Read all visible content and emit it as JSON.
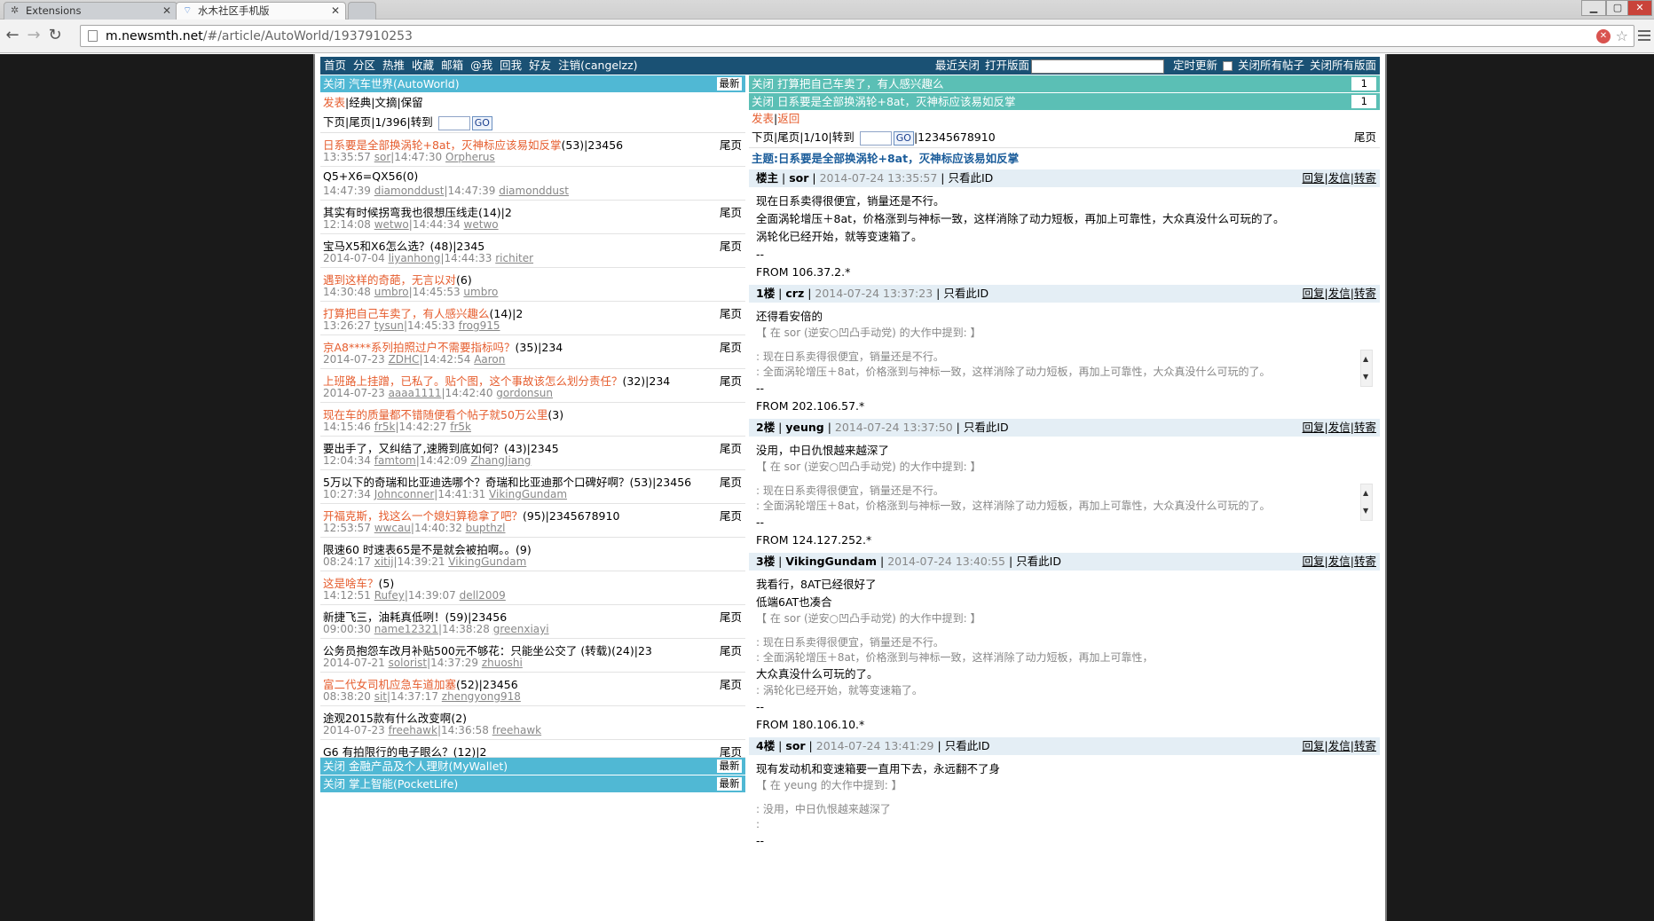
{
  "browser": {
    "tabs": [
      {
        "label": "Extensions",
        "icon": "puzzle-icon"
      },
      {
        "label": "水木社区手机版",
        "icon": "smth-icon"
      }
    ],
    "url_host": "m.newsmth.net",
    "url_path": "/#/article/AutoWorld/1937910253"
  },
  "topbar": {
    "nav": [
      "首页",
      "分区",
      "热推",
      "收藏",
      "邮箱",
      "@我",
      "回我",
      "好友",
      "注销(cangelzz)"
    ],
    "right_links": [
      "最近关闭",
      "打开版面"
    ],
    "refresh": "定时更新",
    "close_all_posts": "关闭所有帖子",
    "close_all_boards": "关闭所有版面"
  },
  "left": {
    "board_bar": {
      "close": "关闭",
      "name": "汽车世界(AutoWorld)",
      "latest": "最新"
    },
    "actions": {
      "post": "发表",
      "rest": "|经典|文摘|保留"
    },
    "pager": {
      "next": "下页",
      "sep1": "|",
      "last": "尾页",
      "sep2": "|",
      "page": "1/396",
      "sep3": "|",
      "goto": "转到",
      "go": "GO"
    },
    "threads": [
      {
        "title": "日系要是全部换涡轮+8at，灭神标应该易如反掌",
        "meta": "(53)|23456",
        "hot": true,
        "tail": "尾页",
        "time": "13:35:57",
        "author": "sor",
        "rtime": "14:47:30",
        "rauthor": "Orpherus"
      },
      {
        "title": "Q5+X6=QX56",
        "meta": "(0)",
        "hot": false,
        "tail": "",
        "time": "14:47:39",
        "author": "diamonddust",
        "rtime": "14:47:39",
        "rauthor": "diamonddust"
      },
      {
        "title": "其实有时候拐弯我也很想压线走",
        "meta": "(14)|2",
        "hot": false,
        "tail": "尾页",
        "time": "12:14:08",
        "author": "wetwo",
        "rtime": "14:44:34",
        "rauthor": "wetwo"
      },
      {
        "title": "宝马X5和X6怎么选？",
        "meta": "(48)|2345",
        "hot": false,
        "tail": "尾页",
        "time": "2014-07-04",
        "author": "liyanhong",
        "rtime": "14:44:33",
        "rauthor": "richiter"
      },
      {
        "title": "遇到这样的奇葩，无言以对",
        "meta": "(6)",
        "hot": true,
        "tail": "",
        "time": "14:30:48",
        "author": "umbro",
        "rtime": "14:45:53",
        "rauthor": "umbro"
      },
      {
        "title": "打算把自己车卖了，有人感兴趣么",
        "meta": "(14)|2",
        "hot": true,
        "tail": "尾页",
        "time": "13:26:27",
        "author": "tysun",
        "rtime": "14:45:33",
        "rauthor": "frog915"
      },
      {
        "title": "京A8****系列拍照过户不需要指标吗？",
        "meta": "(35)|234",
        "hot": true,
        "tail": "尾页",
        "time": "2014-07-23",
        "author": "ZDHC",
        "rtime": "14:42:54",
        "rauthor": "Aaron"
      },
      {
        "title": "上班路上挂蹭，已私了。贴个图，这个事故该怎么划分责任？",
        "meta": "(32)|234",
        "hot": true,
        "tail": "尾页",
        "time": "2014-07-23",
        "author": "aaaa1111",
        "rtime": "14:42:40",
        "rauthor": "gordonsun"
      },
      {
        "title": "现在车的质量都不错随便看个帖子就50万公里",
        "meta": "(3)",
        "hot": true,
        "tail": "",
        "time": "14:15:46",
        "author": "fr5k",
        "rtime": "14:42:27",
        "rauthor": "fr5k"
      },
      {
        "title": "要出手了，又纠结了,速腾到底如何？",
        "meta": "(43)|2345",
        "hot": false,
        "tail": "尾页",
        "time": "12:04:34",
        "author": "famtom",
        "rtime": "14:42:09",
        "rauthor": "ZhangJiang"
      },
      {
        "title": "5万以下的奇瑞和比亚迪选哪个？奇瑞和比亚迪那个口碑好啊？",
        "meta": "(53)|23456",
        "hot": false,
        "tail": "尾页",
        "time": "10:27:34",
        "author": "Johnconner",
        "rtime": "14:41:31",
        "rauthor": "VikingGundam"
      },
      {
        "title": "开福克斯，找这么一个媳妇算稳拿了吧？",
        "meta": "(95)|2345678910",
        "hot": true,
        "tail": "尾页",
        "time": "12:53:57",
        "author": "wwcau",
        "rtime": "14:40:32",
        "rauthor": "bupthzl"
      },
      {
        "title": "限速60 时速表65是不是就会被拍啊。。",
        "meta": "(9)",
        "hot": false,
        "tail": "",
        "time": "08:24:17",
        "author": "xitij",
        "rtime": "14:39:21",
        "rauthor": "VikingGundam"
      },
      {
        "title": "这是啥车？",
        "meta": "(5)",
        "hot": true,
        "tail": "",
        "time": "14:12:51",
        "author": "Rufey",
        "rtime": "14:39:07",
        "rauthor": "dell2009"
      },
      {
        "title": "新捷飞三，油耗真低咧！",
        "meta": "(59)|23456",
        "hot": false,
        "tail": "尾页",
        "time": "09:00:30",
        "author": "name12321",
        "rtime": "14:38:28",
        "rauthor": "greenxiayi"
      },
      {
        "title": "公务员抱怨车改月补贴500元不够花：只能坐公交了 (转载)",
        "meta": "(24)|23",
        "hot": false,
        "tail": "尾页",
        "time": "2014-07-21",
        "author": "solorist",
        "rtime": "14:37:29",
        "rauthor": "zhuoshi"
      },
      {
        "title": "富二代女司机应急车道加塞",
        "meta": "(52)|23456",
        "hot": true,
        "tail": "尾页",
        "time": "08:38:20",
        "author": "sit",
        "rtime": "14:37:17",
        "rauthor": "zhengyong918"
      },
      {
        "title": "途观2015款有什么改变啊",
        "meta": "(2)",
        "hot": false,
        "tail": "",
        "time": "2014-07-23",
        "author": "freehawk",
        "rtime": "14:36:58",
        "rauthor": "freehawk"
      },
      {
        "title": "G6 有拍限行的电子眼么？",
        "meta": "(12)|2",
        "hot": false,
        "tail": "尾页",
        "time": "",
        "author": "",
        "rtime": "",
        "rauthor": ""
      }
    ],
    "bottom_bars": [
      {
        "close": "关闭",
        "name": "金融产品及个人理财(MyWallet)",
        "latest": "最新"
      },
      {
        "close": "关闭",
        "name": "掌上智能(PocketLife)",
        "latest": "最新"
      }
    ]
  },
  "right": {
    "open_posts": [
      {
        "close": "关闭",
        "title": "打算把自己车卖了，有人感兴趣么",
        "count": "1"
      },
      {
        "close": "关闭",
        "title": "日系要是全部换涡轮+8at，灭神标应该易如反掌",
        "count": "1"
      }
    ],
    "actions": {
      "post": "发表",
      "back": "返回"
    },
    "pager": {
      "next": "下页",
      "last": "尾页",
      "page": "1/10",
      "goto": "转到",
      "go": "GO",
      "pages": "12345678910",
      "tail": "尾页"
    },
    "topic": "主题:日系要是全部换涡轮+8at，灭神标应该易如反掌",
    "posts": [
      {
        "floor": "楼主",
        "author": "sor",
        "time": "2014-07-24 13:35:57",
        "only": "只看此ID",
        "ops": [
          "回复",
          "发信",
          "转寄"
        ],
        "lines": [
          "现在日系卖得很便宜，销量还是不行。",
          "全面涡轮增压＋8at，价格涨到与神标一致，这样消除了动力短板，再加上可靠性，大众真没什么可玩的了。",
          "涡轮化已经开始，就等变速箱了。"
        ],
        "sep": "--",
        "quote_head": "",
        "quote": [],
        "after": [],
        "from": "FROM 106.37.2.*"
      },
      {
        "floor": "1楼",
        "author": "crz",
        "time": "2014-07-24 13:37:23",
        "only": "只看此ID",
        "ops": [
          "回复",
          "发信",
          "转寄"
        ],
        "lines": [
          "还得看安倍的"
        ],
        "quote_head": "【 在 sor (逆安○凹凸手动党) 的大作中提到: 】",
        "quote": [
          ": 现在日系卖得很便宜，销量还是不行。",
          ": 全面涡轮增压＋8at，价格涨到与神标一致，这样消除了动力短板，再加上可靠性，大众真没什么可玩的了。"
        ],
        "after": [],
        "sep": "--",
        "from": "FROM 202.106.57.*"
      },
      {
        "floor": "2楼",
        "author": "yeung",
        "time": "2014-07-24 13:37:50",
        "only": "只看此ID",
        "ops": [
          "回复",
          "发信",
          "转寄"
        ],
        "lines": [
          "没用，中日仇恨越来越深了"
        ],
        "quote_head": "【 在 sor (逆安○凹凸手动党) 的大作中提到: 】",
        "quote": [
          ": 现在日系卖得很便宜，销量还是不行。",
          ": 全面涡轮增压＋8at，价格涨到与神标一致，这样消除了动力短板，再加上可靠性，大众真没什么可玩的了。"
        ],
        "after": [],
        "sep": "--",
        "from": "FROM 124.127.252.*"
      },
      {
        "floor": "3楼",
        "author": "VikingGundam",
        "time": "2014-07-24 13:40:55",
        "only": "只看此ID",
        "ops": [
          "回复",
          "发信",
          "转寄"
        ],
        "lines": [
          "我看行，8AT已经很好了",
          "低端6AT也凑合"
        ],
        "quote_head": "【 在 sor (逆安○凹凸手动党) 的大作中提到: 】",
        "quote": [
          ": 现在日系卖得很便宜，销量还是不行。",
          ": 全面涡轮增压＋8at，价格涨到与神标一致，这样消除了动力短板，再加上可靠性，"
        ],
        "after_main": "大众真没什么可玩的了。",
        "after": [
          ": 涡轮化已经开始，就等变速箱了。"
        ],
        "sep": "--",
        "from": "FROM 180.106.10.*"
      },
      {
        "floor": "4楼",
        "author": "sor",
        "time": "2014-07-24 13:41:29",
        "only": "只看此ID",
        "ops": [
          "回复",
          "发信",
          "转寄"
        ],
        "lines": [
          "现有发动机和变速箱要一直用下去，永远翻不了身"
        ],
        "quote_head": "【 在 yeung 的大作中提到: 】",
        "quote": [
          ": 没用，中日仇恨越来越深了",
          ":"
        ],
        "after": [],
        "sep": "--",
        "from": ""
      }
    ]
  },
  "colors": {
    "bar_blue": "#50b8d4",
    "bar_teal": "#5bbfb5",
    "topbar": "#1a5174",
    "hot_title": "#e65d2e"
  }
}
